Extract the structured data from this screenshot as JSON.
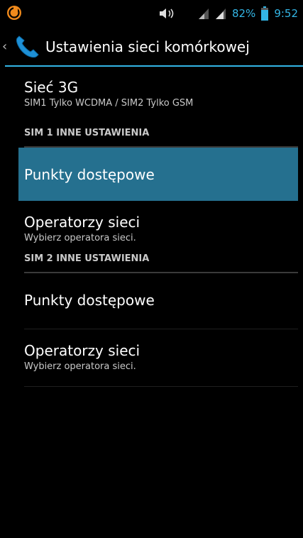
{
  "status_bar": {
    "app_icon": "cm-launcher-icon",
    "volume_icon": "volume-icon",
    "signal_icons": [
      "signal-sim1-icon",
      "signal-sim2-icon"
    ],
    "battery_percent": "82%",
    "battery_icon": "battery-icon",
    "time": "9:52",
    "accent_color": "#33b5e5"
  },
  "action_bar": {
    "back_icon": "chevron-left-icon",
    "app_icon": "phone-icon",
    "title": "Ustawienia sieci komórkowej"
  },
  "list": {
    "network_3g": {
      "title": "Sieć 3G",
      "summary": "SIM1 Tylko WCDMA / SIM2 Tylko GSM"
    },
    "sim1_category": "SIM 1 INNE USTAWIENIA",
    "sim1_items": [
      {
        "title": "Punkty dostępowe",
        "selected": true
      },
      {
        "title": "Operatorzy sieci",
        "summary": "Wybierz operatora sieci."
      }
    ],
    "sim2_category": "SIM 2 INNE USTAWIENIA",
    "sim2_items": [
      {
        "title": "Punkty dostępowe"
      },
      {
        "title": "Operatorzy sieci",
        "summary": "Wybierz operatora sieci."
      }
    ]
  },
  "colors": {
    "background": "#000000",
    "selection": "#25708f",
    "accent": "#33b5e5"
  }
}
